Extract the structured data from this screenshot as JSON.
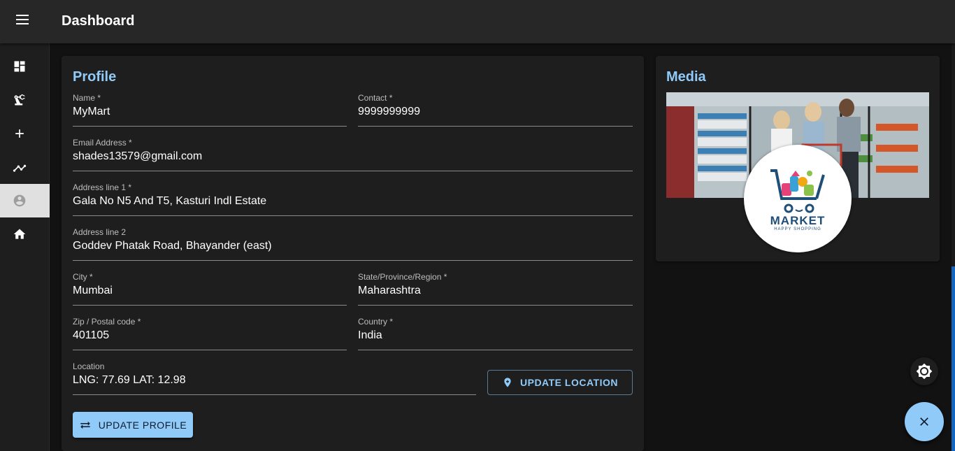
{
  "appbar": {
    "title": "Dashboard"
  },
  "nav": {
    "items": [
      {
        "name": "dashboard",
        "icon": "dashboard-icon"
      },
      {
        "name": "precision-manufacturing",
        "icon": "robot-arm-icon"
      },
      {
        "name": "add",
        "icon": "plus-icon"
      },
      {
        "name": "analytics",
        "icon": "trend-icon"
      },
      {
        "name": "account",
        "icon": "account-circle-icon",
        "active": true
      },
      {
        "name": "home",
        "icon": "home-icon"
      }
    ]
  },
  "profile": {
    "title": "Profile",
    "name": {
      "label": "Name *",
      "value": "MyMart"
    },
    "contact": {
      "label": "Contact *",
      "value": "9999999999"
    },
    "email": {
      "label": "Email Address *",
      "value": "shades13579@gmail.com"
    },
    "address1": {
      "label": "Address line 1 *",
      "value": "Gala No N5 And T5, Kasturi Indl Estate"
    },
    "address2": {
      "label": "Address line 2",
      "value": "Goddev Phatak Road, Bhayander (east)"
    },
    "city": {
      "label": "City *",
      "value": "Mumbai"
    },
    "state": {
      "label": "State/Province/Region *",
      "value": "Maharashtra"
    },
    "zip": {
      "label": "Zip / Postal code *",
      "value": "401105"
    },
    "country": {
      "label": "Country *",
      "value": "India"
    },
    "location": {
      "label": "Location",
      "value": "LNG: 77.69 LAT: 12.98"
    },
    "update_location_label": "UPDATE LOCATION",
    "update_profile_label": "UPDATE PROFILE"
  },
  "media": {
    "title": "Media",
    "logo_text": "MARKET",
    "logo_sub": "HAPPY SHOPPING"
  },
  "colors": {
    "accent": "#90caf9",
    "appbar": "#272727",
    "card": "#1e1e1e",
    "background": "#121212"
  }
}
